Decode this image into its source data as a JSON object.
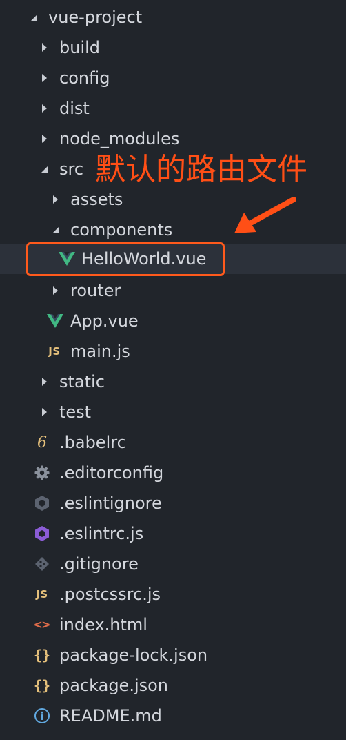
{
  "tree": {
    "root": "vue-project",
    "items": [
      {
        "name": "build"
      },
      {
        "name": "config"
      },
      {
        "name": "dist"
      },
      {
        "name": "node_modules"
      },
      {
        "name": "src"
      },
      {
        "name": "assets"
      },
      {
        "name": "components"
      },
      {
        "name": "HelloWorld.vue"
      },
      {
        "name": "router"
      },
      {
        "name": "App.vue"
      },
      {
        "name": "main.js"
      },
      {
        "name": "static"
      },
      {
        "name": "test"
      },
      {
        "name": ".babelrc"
      },
      {
        "name": ".editorconfig"
      },
      {
        "name": ".eslintignore"
      },
      {
        "name": ".eslintrc.js"
      },
      {
        "name": ".gitignore"
      },
      {
        "name": ".postcssrc.js"
      },
      {
        "name": "index.html"
      },
      {
        "name": "package-lock.json"
      },
      {
        "name": "package.json"
      },
      {
        "name": "README.md"
      }
    ]
  },
  "icons": {
    "js": "JS",
    "babel": "6",
    "html": "<>",
    "json": "{}"
  },
  "annotation": {
    "text": "默认的路由文件"
  },
  "colors": {
    "background": "#21252b",
    "text": "#d4d7dd",
    "vue_green": "#41b883",
    "js_yellow": "#e5c07b",
    "annotation_orange": "#ff4f16"
  }
}
